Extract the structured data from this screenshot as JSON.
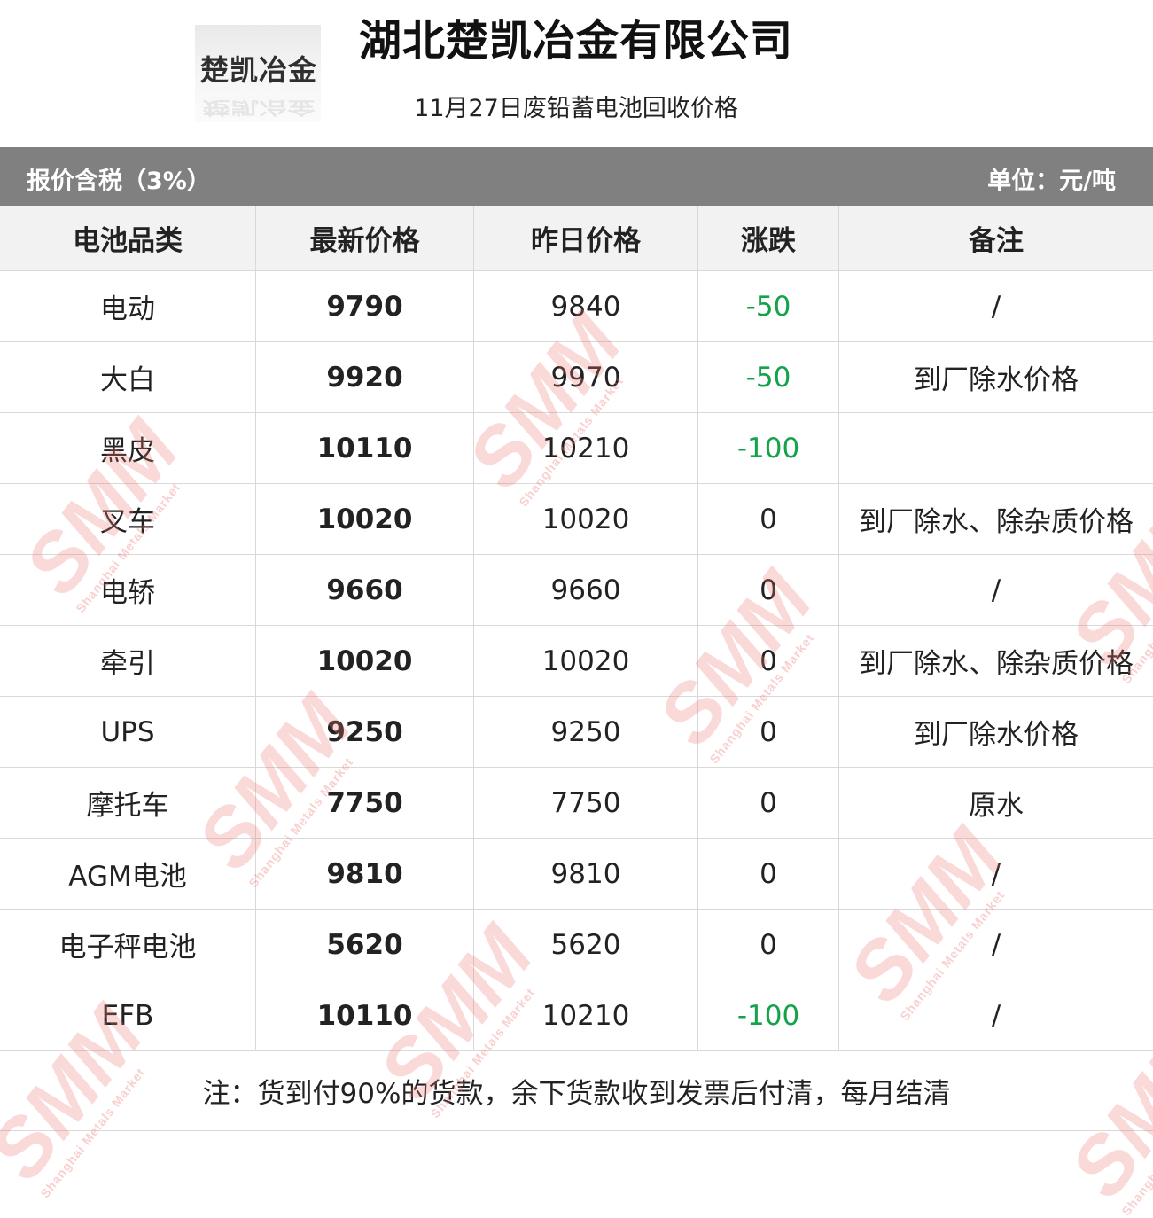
{
  "header": {
    "logo_text": "楚凯冶金",
    "title": "湖北楚凯冶金有限公司",
    "subtitle": "11月27日废铅蓄电池回收价格"
  },
  "info_bar": {
    "left": "报价含税（3%）",
    "right": "单位：元/吨"
  },
  "table": {
    "columns": [
      "电池品类",
      "最新价格",
      "昨日价格",
      "涨跌",
      "备注"
    ],
    "rows": [
      {
        "type": "电动",
        "latest": "9790",
        "yesterday": "9840",
        "change": "-50",
        "note": "/"
      },
      {
        "type": "大白",
        "latest": "9920",
        "yesterday": "9970",
        "change": "-50",
        "note": "到厂除水价格"
      },
      {
        "type": "黑皮",
        "latest": "10110",
        "yesterday": "10210",
        "change": "-100",
        "note": ""
      },
      {
        "type": "叉车",
        "latest": "10020",
        "yesterday": "10020",
        "change": "0",
        "note": "到厂除水、除杂质价格"
      },
      {
        "type": "电轿",
        "latest": "9660",
        "yesterday": "9660",
        "change": "0",
        "note": "/"
      },
      {
        "type": "牵引",
        "latest": "10020",
        "yesterday": "10020",
        "change": "0",
        "note": "到厂除水、除杂质价格"
      },
      {
        "type": "UPS",
        "latest": "9250",
        "yesterday": "9250",
        "change": "0",
        "note": "到厂除水价格"
      },
      {
        "type": "摩托车",
        "latest": "7750",
        "yesterday": "7750",
        "change": "0",
        "note": "原水"
      },
      {
        "type": "AGM电池",
        "latest": "9810",
        "yesterday": "9810",
        "change": "0",
        "note": "/"
      },
      {
        "type": "电子秤电池",
        "latest": "5620",
        "yesterday": "5620",
        "change": "0",
        "note": "/"
      },
      {
        "type": "EFB",
        "latest": "10110",
        "yesterday": "10210",
        "change": "-100",
        "note": "/"
      }
    ]
  },
  "footer": {
    "note": "注：货到付90%的货款，余下货款收到发票后付清，每月结清"
  },
  "watermark": {
    "text": "SMM",
    "subtext": "Shanghai Metals Market"
  },
  "colors": {
    "bar": "#808080",
    "negative": "#14a34a",
    "watermark": "#ee7878"
  }
}
